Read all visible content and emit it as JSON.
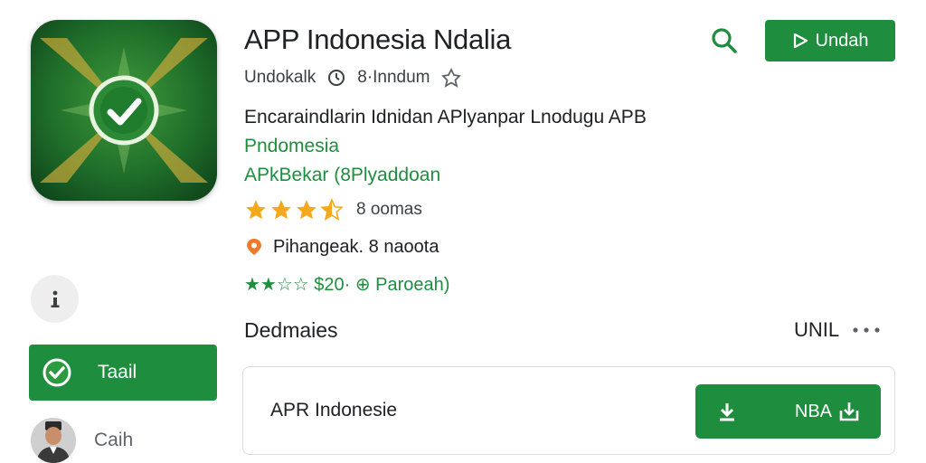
{
  "app": {
    "title": "APP Indonesia Ndalia",
    "developer": "Undokalk",
    "downloads": "8·Inndum",
    "description": "Encaraindlarin Idnidan APlyanpar Lnodugu APB",
    "category_line": "Pndomesia",
    "tags_line": "APkBekar (8Plyaddoan",
    "rating_text": "8 oomas",
    "publisher_text": "Pihangeak. 8 naoota",
    "green_line": "★★☆☆ $20· ⊕ Paroeah)"
  },
  "rating": {
    "value": 3.5,
    "max": 5
  },
  "actions": {
    "install_label": "Undah",
    "section_title": "Dedmaies",
    "section_link": "UNIL",
    "card_label": "APR Indonesie",
    "card_button_label": "NBA"
  },
  "sidebar": {
    "tab_label": "Taail",
    "user_label": "Caih"
  },
  "colors": {
    "accent": "#1e8e3e",
    "star": "#f4a81d",
    "star_green": "#1e8e3e"
  },
  "icons": {
    "search": "search-icon",
    "play": "play-icon",
    "info": "info-icon",
    "download": "download-icon",
    "more": "more-dots-icon"
  }
}
